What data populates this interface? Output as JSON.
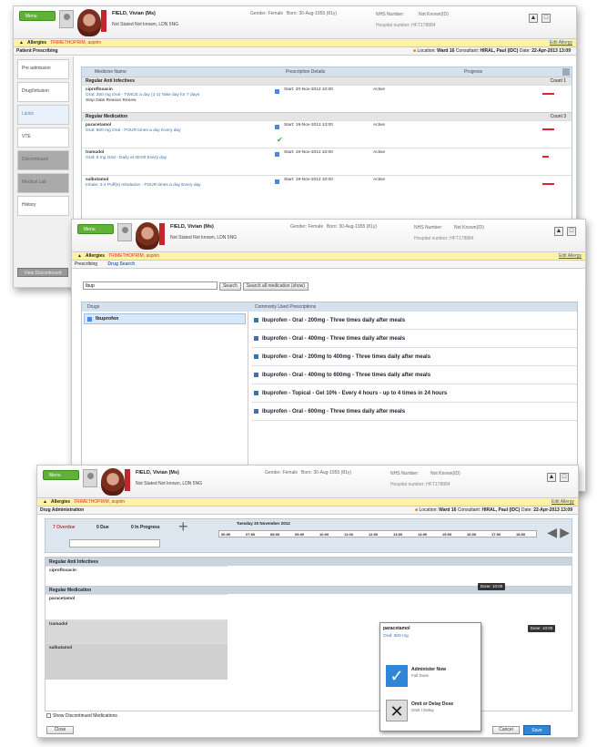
{
  "patient": {
    "name": "FIELD, Vivian (Ms)",
    "address": "Not Stated Not known, LDN 5NG",
    "gender": "Gender: Female",
    "born": "Born: 30-Aug-1955 (81y)",
    "nhs": "NHS Number:",
    "nhs_value": "Not Known(ID)",
    "hospital": "Hospital number: HFT178884"
  },
  "menu_label": "Menu",
  "allergies": {
    "label": "Allergies",
    "value": "TRIMETHOPRIM, aspirin",
    "link": "Edit Allergy"
  },
  "screen1": {
    "title": "Patient Prescribing",
    "location_text": "Location:",
    "ward": "Ward 16",
    "consultant_text": "Consultant:",
    "consultant": "HIRAL, Paul (IDC)",
    "date_text": "Date:",
    "date": "22-Apr-2013 13:09",
    "sidebar": [
      "Pre admission",
      "Drug/Infusion",
      "Lipids",
      "VTE",
      "Discontinued",
      "Medical Lab",
      "History"
    ],
    "bottom_button": "View Discontinued",
    "columns": [
      "Medicine Name",
      "Prescription Details",
      "Progress"
    ],
    "group1": "Regular Anti Infectives",
    "group1_count": "Count 1",
    "group2": "Regular Medication",
    "group2_count": "Count 3",
    "rows": [
      {
        "name": "ciprofloxacin",
        "dose": "Oral: 250 mg   Oral - TWICE a day (1-1)   Take day for 7 days",
        "note": "Stop Date Reason Renew",
        "start": "Start: 20-Nov-2012 10:00",
        "status": "Active"
      },
      {
        "name": "paracetamol",
        "dose": "Oral: 500 mg   Oral - FOUR times a day   Every day",
        "note": "",
        "start": "Start: 19-Nov-2012 13:00",
        "status": "Active"
      },
      {
        "name": "tramadol",
        "dose": "Oral: 5 mg   Oral - Daily at 08:00   Every day",
        "note": "",
        "start": "Start: 19-Nov-2012 10:00",
        "status": "Active"
      },
      {
        "name": "salbutamol",
        "dose": "Inhale: 2-4 Puff(s)   Inhalation - FOUR times a day   Every day",
        "note": "",
        "start": "Start: 19-Nov-2012 10:00",
        "status": "Active"
      }
    ]
  },
  "screen2": {
    "tabs": [
      "Prescribing",
      "Drug Search"
    ],
    "search_value": "Ibup",
    "search_btn": "Search",
    "search_all_btn": "Search all medication (show)",
    "drugs_header": "Drugs",
    "common_header": "Commonly Used Prescriptions",
    "drug_item": "Ibuprofen",
    "prescriptions": [
      "Ibuprofen - Oral - 200mg - Three times daily after meals",
      "Ibuprofen - Oral - 400mg - Three times daily after meals",
      "Ibuprofen - Oral - 200mg to 400mg - Three times daily after meals",
      "Ibuprofen - Oral - 400mg to 600mg - Three times daily after meals",
      "Ibuprofen - Topical - Gel 10% - Every 4 hours - up to 4 times in 24 hours",
      "Ibuprofen - Oral - 600mg - Three times daily after meals"
    ]
  },
  "screen3": {
    "title": "Drug Administration",
    "filters": [
      "7 Overdue",
      "0 Due",
      "0 In Progress"
    ],
    "date_header": "Tuesday 20 November 2012",
    "times": [
      "06:00",
      "07:00",
      "08:00",
      "09:00",
      "10:00",
      "11:00",
      "12:00",
      "13:00",
      "14:00",
      "15:00",
      "16:00",
      "17:00",
      "18:00"
    ],
    "group1": "Regular Anti Infectives",
    "group2": "Regular Medication",
    "rows": [
      "ciprofloxacin",
      "paracetamol",
      "tramadol",
      "salbutamol"
    ],
    "popup_title": "paracetamol",
    "popup_dose": "Oral: 500 mg",
    "popup_ok": "Administer Now",
    "popup_ok_sub": "Full Dose",
    "popup_no": "Omit or Delay Dose",
    "popup_no_sub": "Omit / Delay",
    "done_labels": [
      "Done: 10:00",
      "Done: 10:00"
    ],
    "bottom_check": "Show Discontinued Medications",
    "close_btn": "Close",
    "cancel_btn": "Cancel",
    "save_btn": "Save"
  }
}
